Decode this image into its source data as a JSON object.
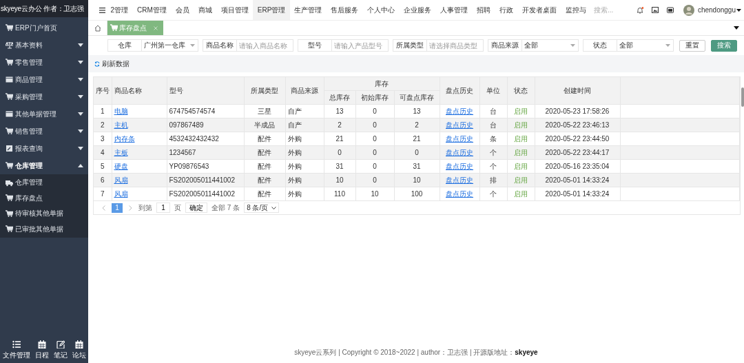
{
  "sidebar": {
    "title": "skyeye云办公 作者：卫志强",
    "items": [
      {
        "label": "ERP门户首页",
        "kind": "link"
      },
      {
        "label": "基本资料",
        "kind": "menu",
        "expanded": false
      },
      {
        "label": "零售管理",
        "kind": "menu",
        "expanded": false
      },
      {
        "label": "商品管理",
        "kind": "menu",
        "expanded": false
      },
      {
        "label": "采购管理",
        "kind": "menu",
        "expanded": false
      },
      {
        "label": "其他单据管理",
        "kind": "menu",
        "expanded": false
      },
      {
        "label": "销售管理",
        "kind": "menu",
        "expanded": false
      },
      {
        "label": "报表查询",
        "kind": "menu",
        "expanded": false
      },
      {
        "label": "仓库管理",
        "kind": "menu",
        "expanded": true,
        "children": [
          {
            "label": "仓库管理"
          },
          {
            "label": "库存盘点"
          },
          {
            "label": "待审核其他单据"
          },
          {
            "label": "已审批其他单据"
          }
        ]
      }
    ],
    "tools": [
      {
        "label": "文件管理"
      },
      {
        "label": "日程"
      },
      {
        "label": "笔记"
      },
      {
        "label": "论坛"
      }
    ]
  },
  "top_nav": {
    "items": [
      {
        "label": "2管理",
        "selected": false
      },
      {
        "label": "CRM管理",
        "selected": false
      },
      {
        "label": "会员",
        "selected": false
      },
      {
        "label": "商城",
        "selected": false
      },
      {
        "label": "项目管理",
        "selected": false
      },
      {
        "label": "ERP管理",
        "selected": true
      },
      {
        "label": "生产管理",
        "selected": false
      },
      {
        "label": "售后服务",
        "selected": false
      },
      {
        "label": "个人中心",
        "selected": false
      },
      {
        "label": "企业服务",
        "selected": false
      },
      {
        "label": "人事管理",
        "selected": false
      },
      {
        "label": "招聘",
        "selected": false
      },
      {
        "label": "行政",
        "selected": false
      },
      {
        "label": "开发者桌面",
        "selected": false
      },
      {
        "label": "监控与",
        "selected": false
      }
    ],
    "search": {
      "placeholder": "搜索..."
    },
    "user": "chendonggu"
  },
  "tabs": [
    {
      "label": "库存盘点",
      "selected": true
    }
  ],
  "filters": [
    {
      "label": "仓库",
      "kind": "select",
      "value": "广州第一仓库"
    },
    {
      "label": "商品名称",
      "kind": "input",
      "placeholder": "请输入商品名称"
    },
    {
      "label": "型号",
      "kind": "input",
      "placeholder": "请输入产品型号"
    },
    {
      "label": "所属类型",
      "kind": "input",
      "placeholder": "请选择商品类型"
    },
    {
      "label": "商品来源",
      "kind": "select",
      "value": "全部"
    },
    {
      "label": "状态",
      "kind": "select",
      "value": "全部"
    }
  ],
  "buttons": [
    {
      "label": "重置",
      "kind": "plain"
    },
    {
      "label": "搜索",
      "kind": "primary"
    }
  ],
  "refresh": "刷新数据",
  "table": {
    "columns": [
      "序号",
      "商品名称",
      "型号",
      "所属类型",
      "商品来源",
      {
        "label": "库存",
        "colspan": 3,
        "children": [
          "总库存",
          "初始库存",
          "可盘点库存"
        ]
      },
      "盘点历史",
      "单位",
      "状态",
      "创建时间"
    ],
    "rows": [
      [
        "1",
        "电脑",
        "674754574574",
        "三星",
        "自产",
        "13",
        "0",
        "13",
        "盘点历史",
        "台",
        "启用",
        "2020-05-23 17:58:26"
      ],
      [
        "2",
        "主机",
        "097867489",
        "半成品",
        "自产",
        "2",
        "0",
        "2",
        "盘点历史",
        "台",
        "启用",
        "2020-05-22 23:46:13"
      ],
      [
        "3",
        "内存条",
        "4532432432432",
        "配件",
        "外购",
        "21",
        "0",
        "21",
        "盘点历史",
        "条",
        "启用",
        "2020-05-22 23:44:50"
      ],
      [
        "4",
        "主板",
        "1234567",
        "配件",
        "外购",
        "0",
        "0",
        "0",
        "盘点历史",
        "个",
        "启用",
        "2020-05-22 23:44:17"
      ],
      [
        "5",
        "硬盘",
        "YP09876543",
        "配件",
        "外购",
        "31",
        "0",
        "31",
        "盘点历史",
        "个",
        "启用",
        "2020-05-16 23:35:04"
      ],
      [
        "6",
        "风扇",
        "FS202005011441002",
        "配件",
        "外购",
        "10",
        "0",
        "10",
        "盘点历史",
        "排",
        "启用",
        "2020-05-01 14:33:24"
      ],
      [
        "7",
        "风扇",
        "FS202005011441002",
        "配件",
        "外购",
        "110",
        "10",
        "100",
        "盘点历史",
        "个",
        "启用",
        "2020-05-01 14:33:24"
      ]
    ]
  },
  "pagination": {
    "pages": [
      {
        "label": "1",
        "selected": true
      }
    ],
    "goto_label": "到第",
    "goto_value": "1",
    "page_unit": "页",
    "confirm": "确定",
    "total": "全部 7 条",
    "page_size": "8 条/页"
  },
  "footer": "skyeye云系列 | Copyright © 2018~2022 | author：卫志强 | 开源版地址：**skyeye**"
}
